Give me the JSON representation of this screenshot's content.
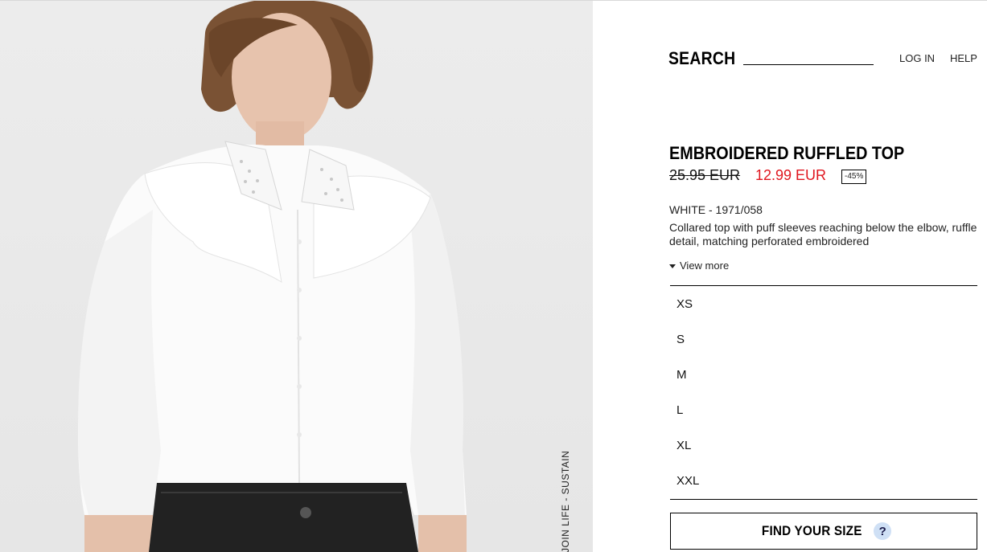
{
  "header": {
    "search_label": "SEARCH",
    "search_placeholder": "",
    "login_label": "LOG IN",
    "help_label": "HELP"
  },
  "product": {
    "title": "EMBROIDERED RUFFLED TOP",
    "old_price": "25.95 EUR",
    "new_price": "12.99 EUR",
    "discount": "-45%",
    "color_ref": "WHITE - 1971/058",
    "description": "Collared top with puff sleeves reaching below the elbow, ruffle detail, matching perforated embroidered",
    "view_more_label": "View more",
    "sizes": [
      "XS",
      "S",
      "M",
      "L",
      "XL",
      "XXL"
    ],
    "find_size_label": "FIND YOUR SIZE",
    "find_size_icon": "?"
  },
  "image": {
    "side_link_label": "JOIN LIFE - SUSTAINABILITY"
  },
  "colors": {
    "sale_red": "#e0161f",
    "help_badge": "#cfe0f5"
  }
}
